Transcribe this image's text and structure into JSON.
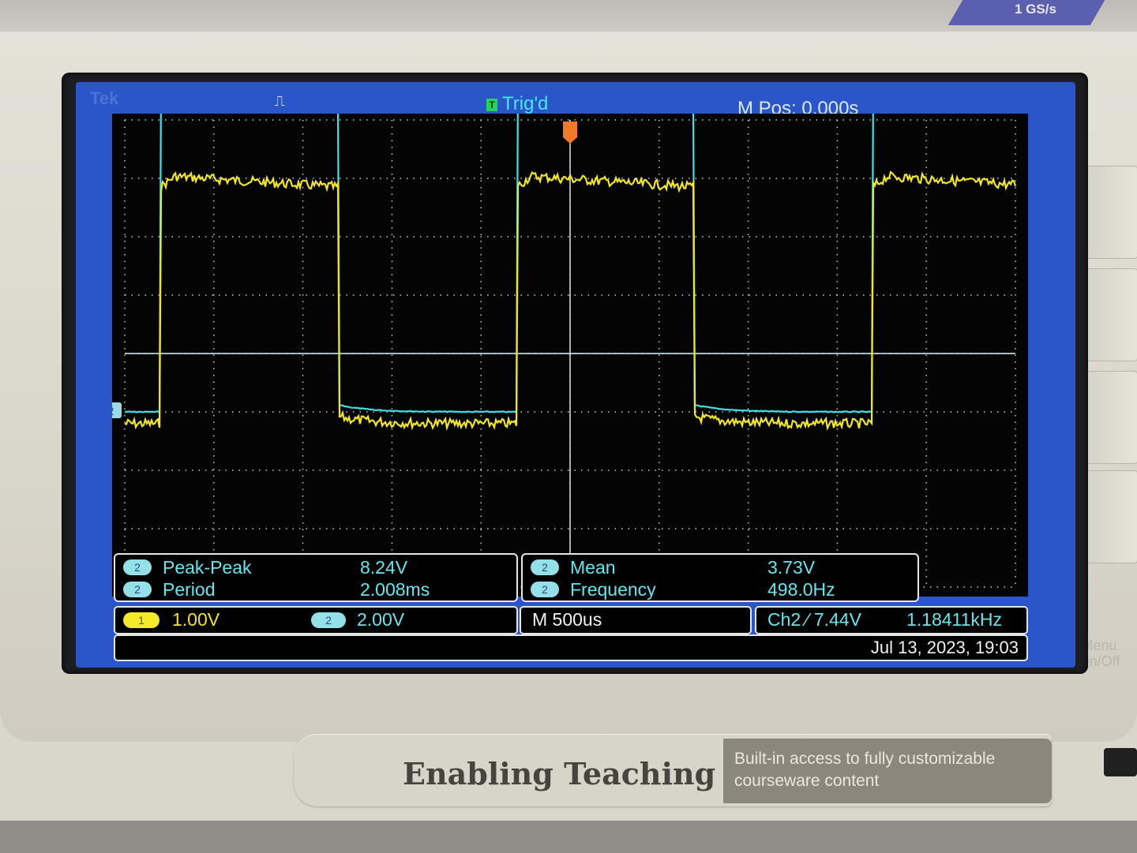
{
  "instrument": {
    "sample_rate": "1 GS/s",
    "plate_title": "Enabling Teaching",
    "plate_subtitle": "Built-in access to fully customizable courseware content",
    "menu_button": "Menu On/Off"
  },
  "header": {
    "brand": "Tek",
    "trigger_status": "Trig'd",
    "trigger_icon": "T",
    "acquisition_icon": "pulse-icon",
    "horizontal_position": "M Pos: 0.000s"
  },
  "measurements": {
    "left": [
      {
        "channel": "2",
        "label": "Peak-Peak",
        "value": "8.24V"
      },
      {
        "channel": "2",
        "label": "Period",
        "value": "2.008ms"
      }
    ],
    "right": [
      {
        "channel": "2",
        "label": "Mean",
        "value": "3.73V"
      },
      {
        "channel": "2",
        "label": "Frequency",
        "value": "498.0Hz"
      }
    ]
  },
  "status": {
    "ch1_chip": "1",
    "ch1_scale": "1.00V",
    "ch2_chip": "2",
    "ch2_scale": "2.00V",
    "timebase": "M 500us",
    "trigger": "Ch2 ∕ 7.44V",
    "trigger_freq": "1.18411kHz",
    "datetime": "Jul 13, 2023, 19:03"
  },
  "ch2_marker": "2",
  "colors": {
    "ch1": "#f2e61c",
    "ch2": "#3fe0e6",
    "screen_border": "#2b56c9",
    "graticule": "#cfcfcf",
    "trigger_marker": "#f07a2a"
  },
  "waveforms": {
    "period_divisions": 4.0,
    "ch2_low_div": -1.0,
    "ch2_high_div": 4.9,
    "ch1_low_div": -1.2,
    "ch1_high_div": 3.05
  }
}
